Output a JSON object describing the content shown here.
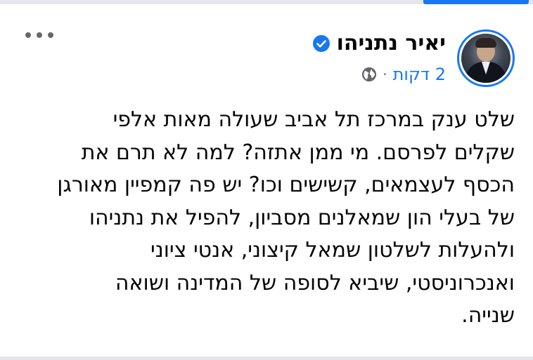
{
  "post": {
    "author_name": "יאיר נתניהו",
    "verified": true,
    "time": "2 דקות",
    "separator": "·",
    "audience_icon": "globe-icon",
    "more_icon": "more-options-icon",
    "body_lines": [
      "שלט ענק במרכז תל אביב שעולה מאות אלפי",
      "שקלים לפרסם. מי ממן אתזה? למה לא תרם את",
      "הכסף לעצמאים, קשישים וכו? יש פה קמפיין מאורגן",
      "של בעלי הון שמאלנים מסביון, להפיל את נתניהו",
      "ולהעלות לשלטון שמאל קיצוני, אנטי ציוני",
      "ואנכרוניסטי,  שיביא לסופה של המדינה ושואה",
      "שנייה."
    ]
  },
  "colors": {
    "accent": "#1877f2",
    "text": "#050505",
    "muted": "#65676b"
  }
}
